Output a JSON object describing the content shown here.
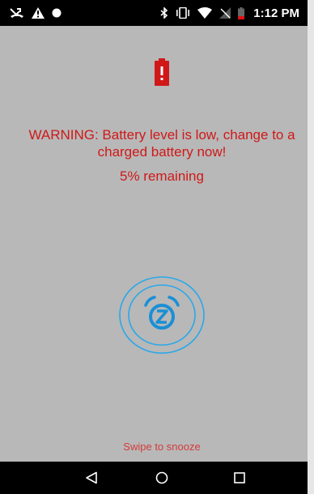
{
  "status_bar": {
    "time": "1:12 PM",
    "left_icons": [
      "missed-call-icon",
      "alert-triangle-icon",
      "dot-icon"
    ],
    "right_icons": [
      "bluetooth-icon",
      "vibrate-icon",
      "wifi-icon",
      "no-signal-icon",
      "battery-low-icon"
    ]
  },
  "alert": {
    "icon": "battery-alert-icon",
    "warning_line1": "WARNING: Battery level is low, change to a",
    "warning_line2": "charged battery now!",
    "remaining": "5% remaining",
    "snooze_icon": "snooze-alarm-icon",
    "swipe_text": "Swipe to snooze"
  },
  "navigation": {
    "buttons": [
      "back",
      "home",
      "recents"
    ]
  },
  "colors": {
    "background": "#b8b8b8",
    "alert_red": "#d01818",
    "snooze_blue": "#29a8e8"
  }
}
